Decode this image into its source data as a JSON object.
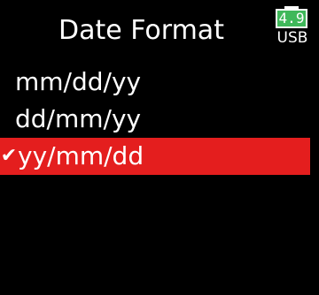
{
  "screen": {
    "title": "Date Format"
  },
  "status": {
    "battery_level": "4.9",
    "power_source": "USB",
    "battery_color": "#3fb85a"
  },
  "options": [
    {
      "label": "mm/dd/yy",
      "selected": false
    },
    {
      "label": "dd/mm/yy",
      "selected": false
    },
    {
      "label": "yy/mm/dd",
      "selected": true
    }
  ],
  "colors": {
    "background": "#000000",
    "selection": "#e41e1e",
    "text": "#ffffff"
  },
  "icons": {
    "selected_marker": "checkmark-icon"
  }
}
